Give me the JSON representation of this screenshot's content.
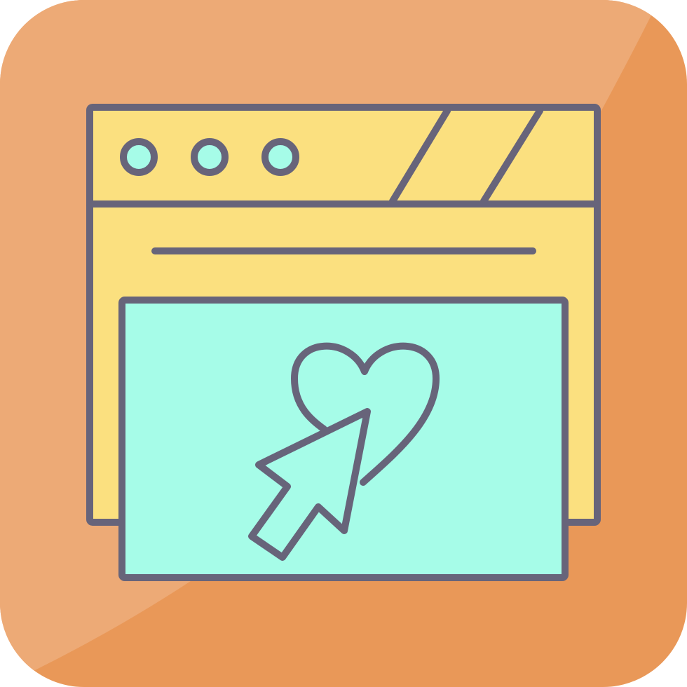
{
  "icon": {
    "name": "web-favorite-click-icon",
    "colors": {
      "tile_light": "#EDAA76",
      "tile_dark": "#E99858",
      "stroke": "#67647A",
      "window_yellow": "#FBE07F",
      "panel_mint": "#A6FCE8"
    },
    "window_dots": [
      "dot-1",
      "dot-2",
      "dot-3"
    ],
    "symbols": [
      "heart-icon",
      "cursor-arrow-icon"
    ]
  }
}
